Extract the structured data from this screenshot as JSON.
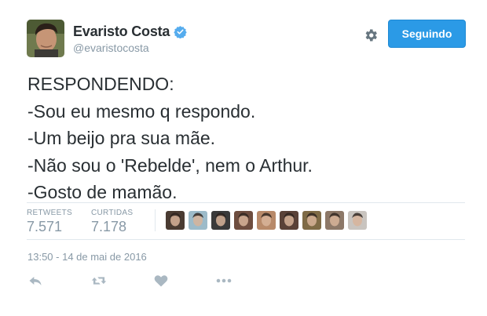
{
  "user": {
    "name": "Evaristo Costa",
    "handle": "@evaristocosta"
  },
  "follow_button": {
    "label": "Seguindo"
  },
  "tweet": {
    "lines": [
      "RESPONDENDO:",
      "-Sou eu mesmo q respondo.",
      "-Um beijo pra sua mãe.",
      "-Não sou o 'Rebelde', nem o Arthur.",
      "-Gosto de mamão."
    ]
  },
  "stats": {
    "retweets": {
      "label": "RETWEETS",
      "value": "7.571"
    },
    "likes": {
      "label": "CURTIDAS",
      "value": "7.178"
    }
  },
  "favoriters": [
    {
      "color": "#4a3b32"
    },
    {
      "color": "#9dbbc9"
    },
    {
      "color": "#3a3a3a"
    },
    {
      "color": "#6e4d3f"
    },
    {
      "color": "#b88a6a"
    },
    {
      "color": "#5a4238"
    },
    {
      "color": "#7f6b46"
    },
    {
      "color": "#8d7868"
    },
    {
      "color": "#c9c4bf"
    }
  ],
  "timestamp": "13:50 - 14 de mai de 2016",
  "colors": {
    "accent": "#2b9ae6",
    "muted": "#8899a6",
    "action_icon": "#aab8c2"
  },
  "icons": {
    "verified": "verified-badge-icon",
    "settings": "gear-icon",
    "reply": "reply-icon",
    "retweet": "retweet-icon",
    "like": "heart-icon",
    "more": "more-icon"
  }
}
